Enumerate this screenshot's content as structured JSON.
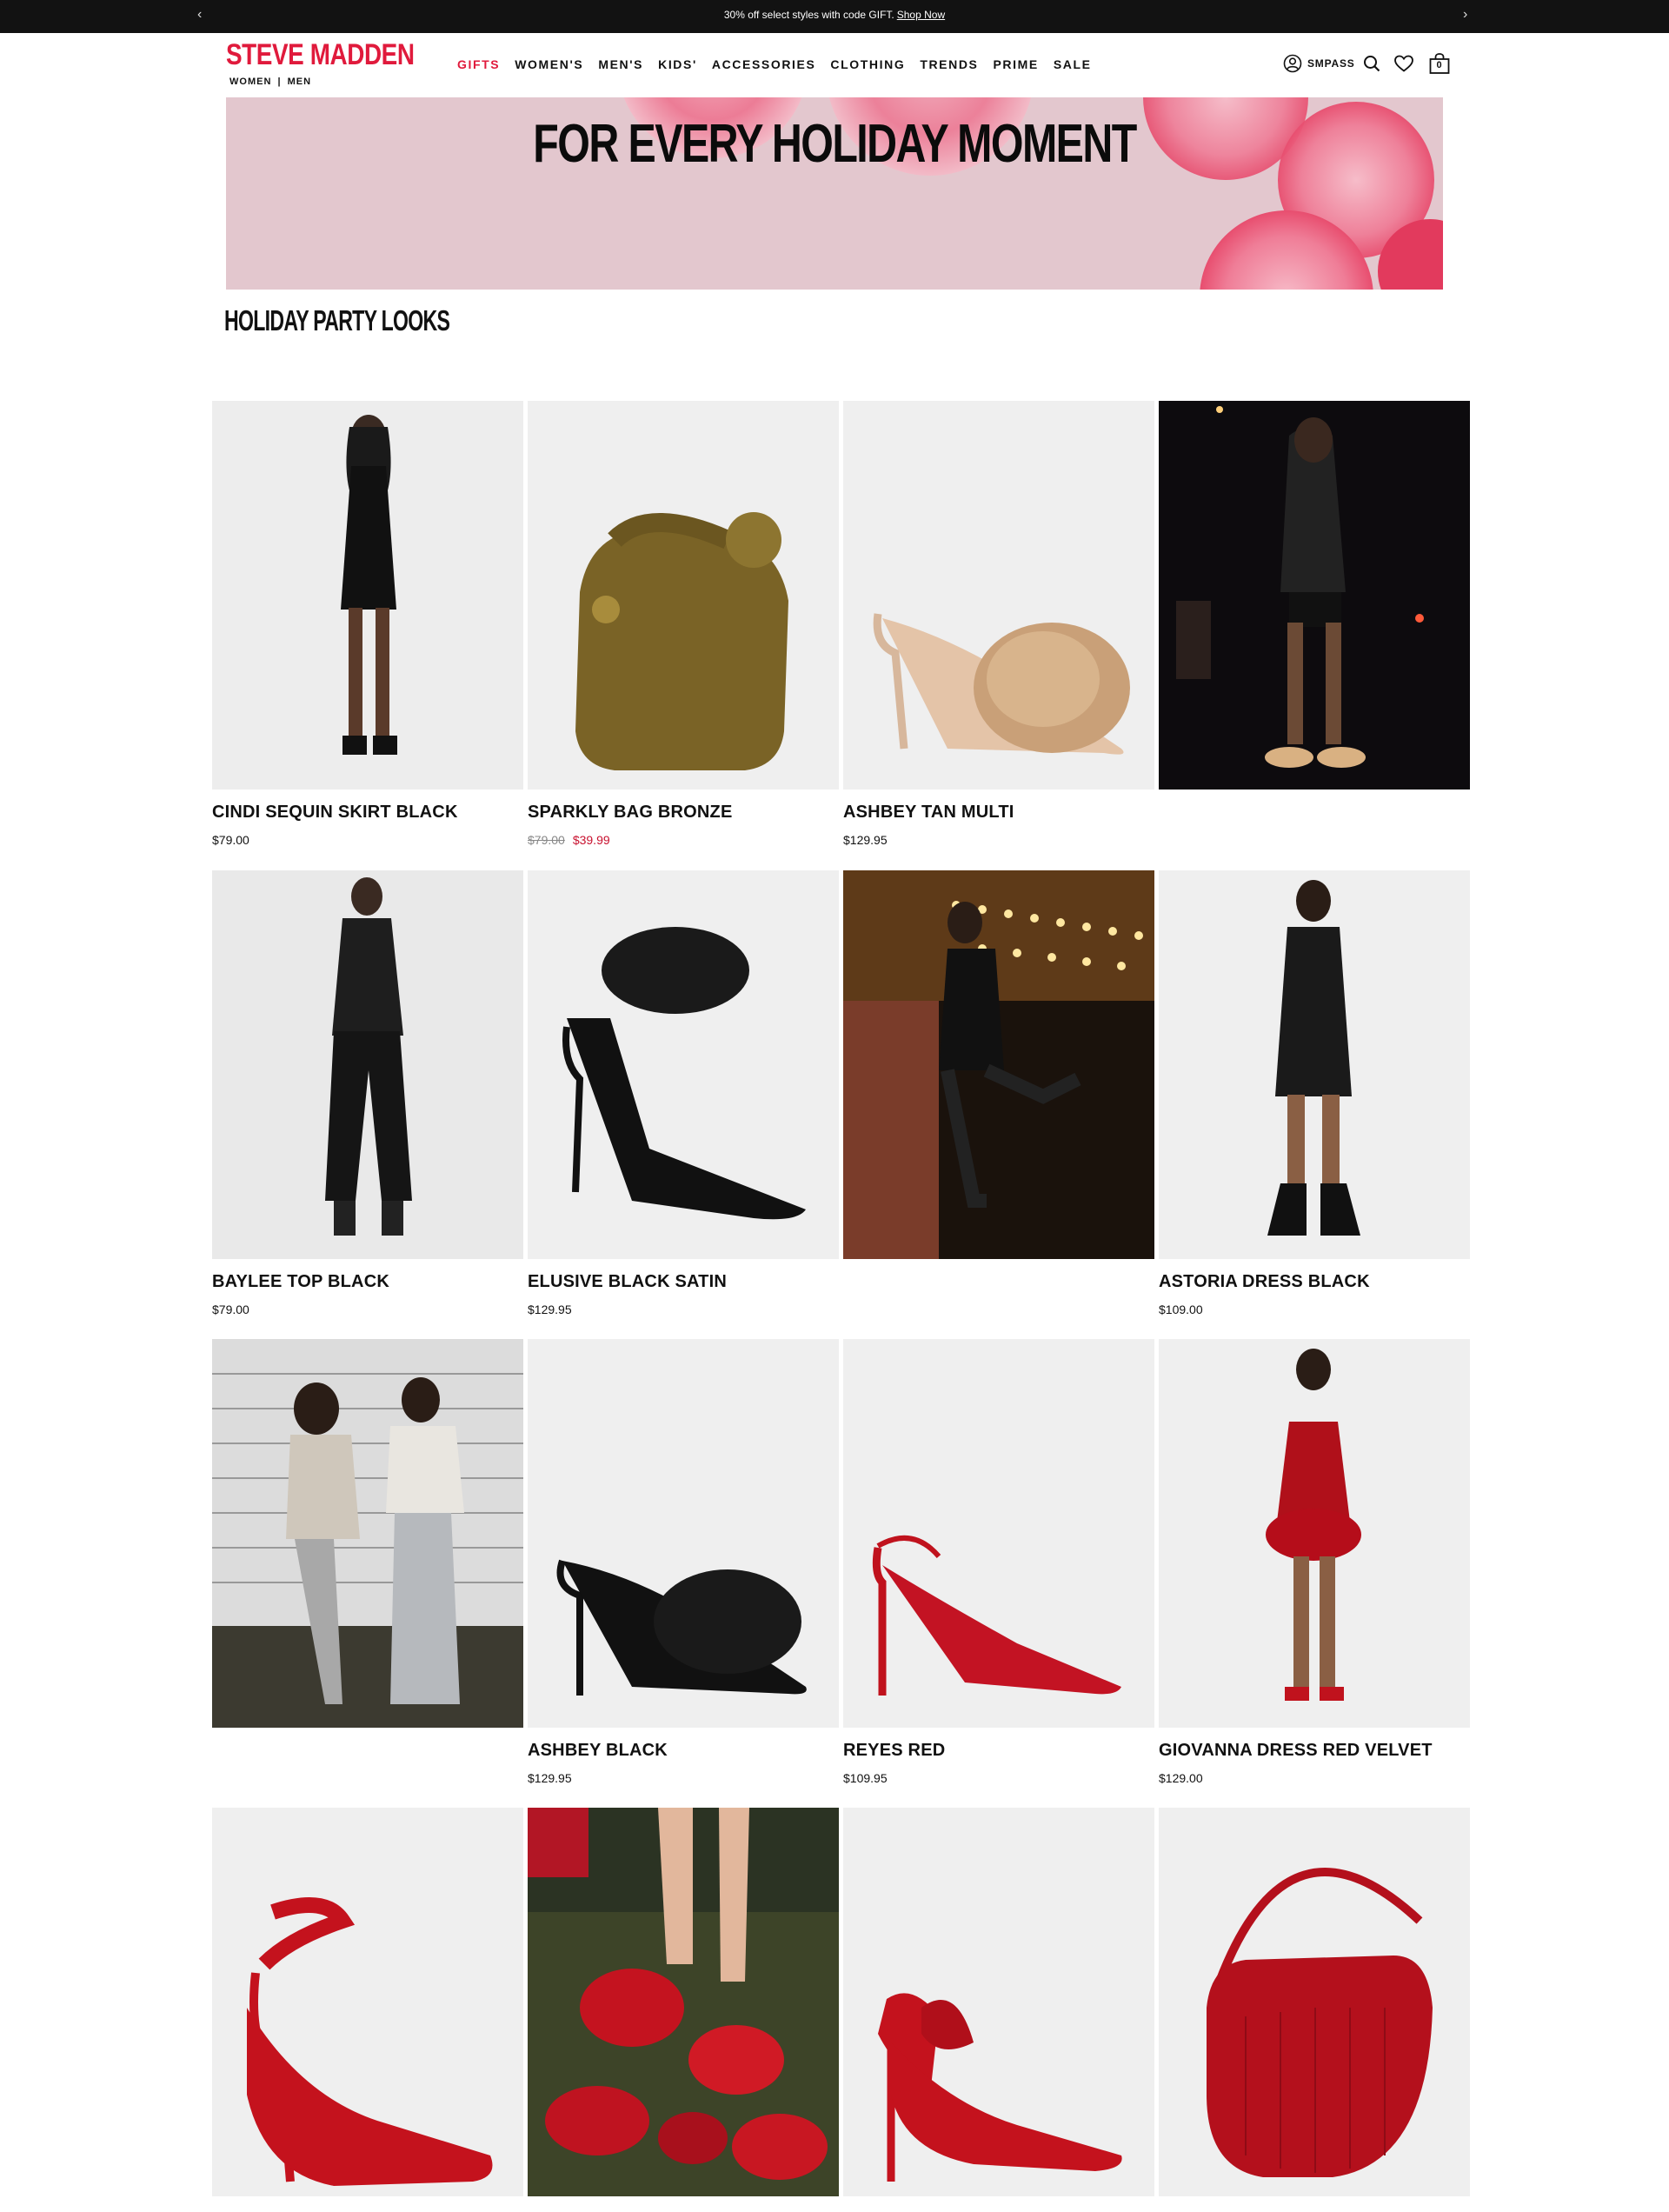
{
  "promo": {
    "text": "30% off select styles with code GIFT.",
    "link": "Shop Now",
    "prev_arrow": "‹",
    "next_arrow": "›"
  },
  "header": {
    "logo": "STEVE MADDEN",
    "gender": {
      "women": "WOMEN",
      "separator": "|",
      "men": "MEN"
    },
    "nav": [
      "GIFTS",
      "WOMEN'S",
      "MEN'S",
      "KIDS'",
      "ACCESSORIES",
      "CLOTHING",
      "TRENDS",
      "PRIME",
      "SALE"
    ],
    "active_nav": "GIFTS",
    "smpass_label": "SMPASS",
    "bag_count": "0",
    "icons": [
      "account-icon",
      "search-icon",
      "heart-icon",
      "bag-icon"
    ]
  },
  "hero": {
    "title": "FOR EVERY HOLIDAY MOMENT"
  },
  "section": {
    "title": "HOLIDAY PARTY LOOKS"
  },
  "colors": {
    "brand": "#e01a3c",
    "sale": "#c8102e",
    "promo_bg": "#121212",
    "hero_bg": "#e4c8cf"
  },
  "tiles": [
    {
      "name": "CINDI SEQUIN SKIRT BLACK",
      "price": "$79.00",
      "image": "model-black-sequin-outfit"
    },
    {
      "name": "SPARKLY BAG BRONZE",
      "price_orig": "$79.00",
      "price_sale": "$39.99",
      "image": "bronze-sparkly-bag"
    },
    {
      "name": "ASHBEY TAN MULTI",
      "price": "$129.95",
      "image": "tan-feather-heel-mule"
    },
    {
      "image": "lifestyle-night-street"
    },
    {
      "name": "BAYLEE TOP BLACK",
      "price": "$79.00",
      "image": "model-lace-top-leather-pants"
    },
    {
      "name": "ELUSIVE BLACK SATIN",
      "price": "$129.95",
      "image": "black-feather-ankle-pump"
    },
    {
      "image": "lifestyle-theater-marquee"
    },
    {
      "name": "ASTORIA DRESS BLACK",
      "price": "$109.00",
      "image": "model-black-mini-dress"
    },
    {
      "image": "lifestyle-friends-tile-wall"
    },
    {
      "name": "ASHBEY BLACK",
      "price": "$129.95",
      "image": "black-feather-heel-mule"
    },
    {
      "name": "REYES RED",
      "price": "$109.95",
      "image": "red-patent-slingback"
    },
    {
      "name": "GIOVANNA DRESS RED VELVET",
      "price": "$129.00",
      "image": "model-red-velvet-dress"
    },
    {
      "image": "red-satin-wrap-heel"
    },
    {
      "image": "lifestyle-red-shoes-pile"
    },
    {
      "image": "red-bow-pump"
    },
    {
      "image": "red-croc-shoulder-bag"
    }
  ]
}
